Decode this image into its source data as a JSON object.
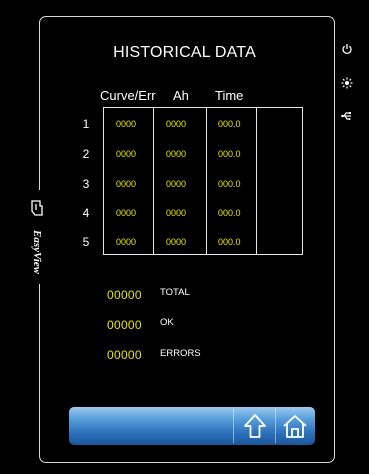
{
  "screen": {
    "title": "HISTORICAL DATA"
  },
  "brand": {
    "name": "EasyView"
  },
  "table": {
    "headers": [
      "Curve/Err",
      "Ah",
      "Time"
    ],
    "rows": [
      {
        "num": "1",
        "curve": "0000",
        "ah": "0000",
        "time": "000.0"
      },
      {
        "num": "2",
        "curve": "0000",
        "ah": "0000",
        "time": "000.0"
      },
      {
        "num": "3",
        "curve": "0000",
        "ah": "0000",
        "time": "000.0"
      },
      {
        "num": "4",
        "curve": "0000",
        "ah": "0000",
        "time": "000.0"
      },
      {
        "num": "5",
        "curve": "0000",
        "ah": "0000",
        "time": "000.0"
      }
    ]
  },
  "stats": [
    {
      "value": "00000",
      "label": "TOTAL"
    },
    {
      "value": "00000",
      "label": "OK"
    },
    {
      "value": "00000",
      "label": "ERRORS"
    }
  ],
  "colors": {
    "value_yellow": "#e6e600",
    "bar_blue": "#2a6fb8"
  },
  "icons": [
    "power-icon",
    "brightness-icon",
    "usb-icon",
    "up-arrow-icon",
    "home-icon",
    "touch-hand-icon"
  ]
}
